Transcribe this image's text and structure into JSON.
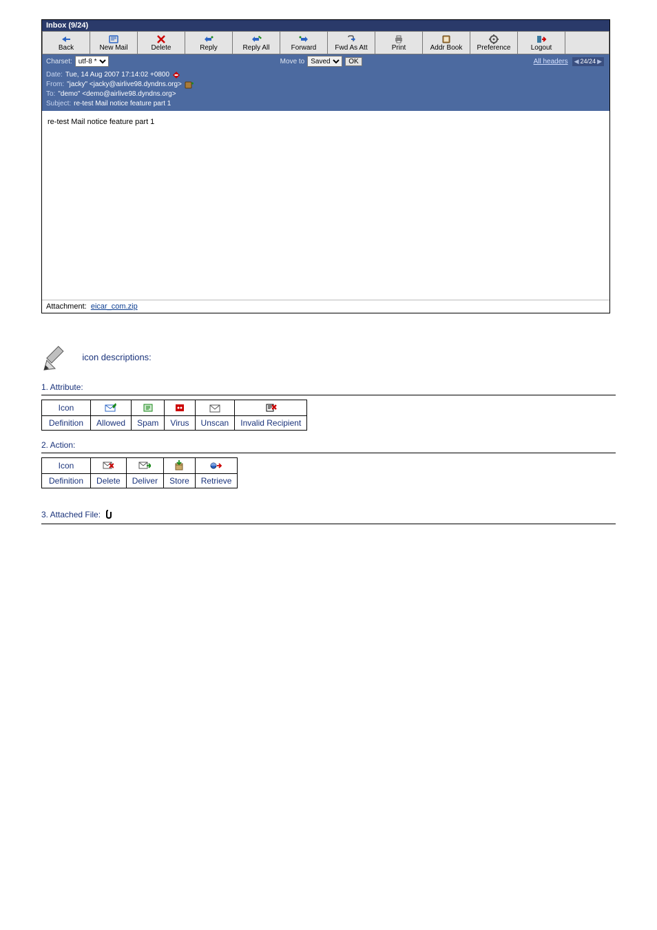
{
  "window": {
    "title": "Inbox (9/24)"
  },
  "toolbar": {
    "back": "Back",
    "newmail": "New Mail",
    "delete": "Delete",
    "reply": "Reply",
    "replyall": "Reply All",
    "forward": "Forward",
    "fwdatt": "Fwd As Att",
    "print": "Print",
    "addrbook": "Addr Book",
    "preference": "Preference",
    "logout": "Logout"
  },
  "subbar": {
    "charset_label": "Charset:",
    "charset_value": "utf-8 *",
    "moveto_label": "Move to",
    "moveto_value": "Saved",
    "ok": "OK",
    "allheaders": "All headers",
    "pos": "24/24"
  },
  "header": {
    "date_k": "Date:",
    "date_v": "Tue, 14 Aug 2007 17:14:02 +0800",
    "from_k": "From:",
    "from_v": "\"jacky\" <jacky@airlive98.dyndns.org>",
    "to_k": "To:",
    "to_v": "\"demo\" <demo@airlive98.dyndns.org>",
    "subj_k": "Subject:",
    "subj_v": "re-test Mail notice feature part 1"
  },
  "body": {
    "text": "re-test Mail notice feature part 1"
  },
  "attachment": {
    "label": "Attachment:",
    "file": "eicar_com.zip"
  },
  "notes": {
    "title": "icon descriptions:",
    "s1": "1. Attribute:",
    "s2": "2. Action:",
    "s3": "3. Attached File:",
    "col_icon": "Icon",
    "col_def": "Definition",
    "attr": {
      "allowed": "Allowed",
      "spam": "Spam",
      "virus": "Virus",
      "unscan": "Unscan",
      "invalid": "Invalid Recipient"
    },
    "act": {
      "delete": "Delete",
      "deliver": "Deliver",
      "store": "Store",
      "retrieve": "Retrieve"
    }
  }
}
